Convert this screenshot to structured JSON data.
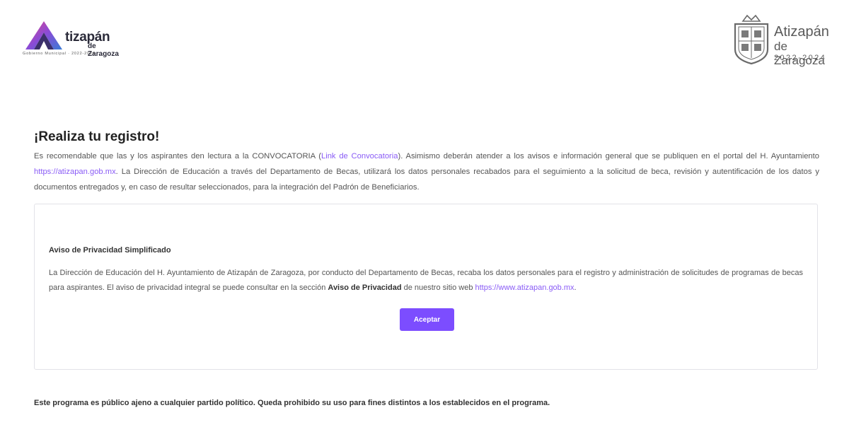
{
  "header": {
    "left_logo": {
      "line1": "tizapán",
      "line2": "de Zaragoza",
      "line3": "Gobierno Municipal · 2022-2024"
    },
    "right_logo": {
      "line1": "Atizapán",
      "line2": "de Zaragoza",
      "line3": "2022-2024"
    }
  },
  "main": {
    "title": "¡Realiza tu registro!",
    "intro": {
      "part1": "Es recomendable que las y los aspirantes den lectura a la CONVOCATORIA (",
      "link1": "Link de Convocatoria",
      "part2": "). Asimismo deberán atender a los avisos e información general que se publiquen en el portal del H. Ayuntamiento ",
      "link2": "https://atizapan.gob.mx",
      "part3": ". La Dirección de Educación a través del Departamento de Becas, utilizará los datos personales recabados para el seguimiento a la solicitud de beca, revisión y autentificación de los datos y documentos entregados y, en caso de resultar seleccionados, para la integración del Padrón de Beneficiarios."
    },
    "card": {
      "title": "Aviso de Privacidad Simplificado",
      "part1": "La Dirección de Educación del H. Ayuntamiento de Atizapán de Zaragoza, por conducto del Departamento de Becas, recaba los datos personales para el registro y administración de solicitudes de programas de becas para aspirantes. El aviso de privacidad integral se puede consultar en la sección ",
      "bold": "Aviso de Privacidad",
      "part2": " de nuestro sitio web ",
      "link": "https://www.atizapan.gob.mx",
      "part3": ".",
      "button_label": "Aceptar"
    }
  },
  "footer": {
    "text": "Este programa es público ajeno a cualquier partido político. Queda prohibido su uso para fines distintos a los establecidos en el programa."
  },
  "colors": {
    "accent": "#7c4dff",
    "link": "#8a5cf6"
  }
}
